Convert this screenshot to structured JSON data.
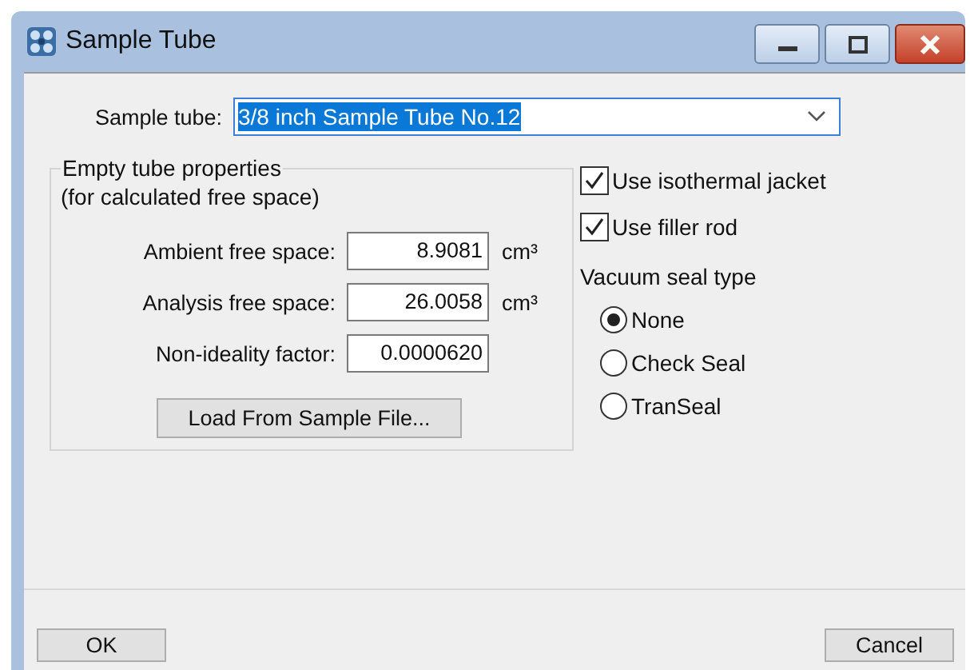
{
  "window": {
    "title": "Sample Tube"
  },
  "sample_tube": {
    "label": "Sample tube:",
    "value": "3/8 inch Sample Tube No.12"
  },
  "properties": {
    "title": "Empty tube properties",
    "subtitle": "(for calculated free space)",
    "fields": [
      {
        "label": "Ambient free space:",
        "value": "8.9081",
        "unit": "cm³"
      },
      {
        "label": "Analysis free space:",
        "value": "26.0058",
        "unit": "cm³"
      },
      {
        "label": "Non-ideality factor:",
        "value": "0.0000620"
      }
    ],
    "load_button": "Load From Sample File..."
  },
  "options": [
    {
      "label": "Use isothermal jacket",
      "checked": true
    },
    {
      "label": "Use filler rod",
      "checked": true
    }
  ],
  "seal": {
    "title": "Vacuum seal type",
    "options": [
      {
        "label": "None",
        "selected": true
      },
      {
        "label": "Check Seal",
        "selected": false
      },
      {
        "label": "TranSeal",
        "selected": false
      }
    ]
  },
  "buttons": [
    "OK",
    "Cancel"
  ]
}
